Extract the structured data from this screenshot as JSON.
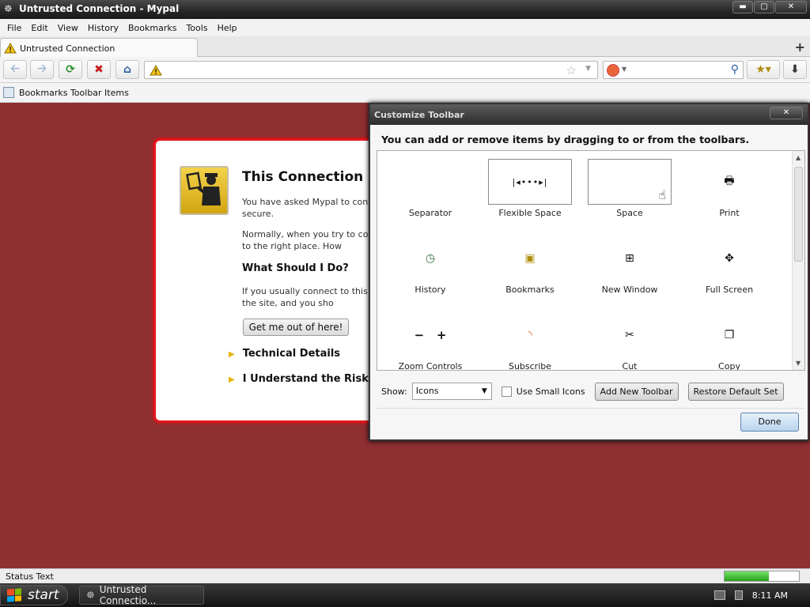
{
  "window": {
    "title": "Untrusted Connection - Mypal",
    "controls": {
      "minimize": "▬",
      "maximize": "▢",
      "close": "✕"
    }
  },
  "menubar": {
    "items": [
      "File",
      "Edit",
      "View",
      "History",
      "Bookmarks",
      "Tools",
      "Help"
    ]
  },
  "tabs": {
    "active_label": "Untrusted Connection",
    "new_tab_symbol": "+"
  },
  "navbar": {
    "url_value": "",
    "search_value": ""
  },
  "bookmarks_toolbar": {
    "item_label": "Bookmarks Toolbar Items"
  },
  "error_page": {
    "title": "This Connection is",
    "para1": "You have asked Mypal to connect connection is secure.",
    "para2": "Normally, when you try to connect are going to the right place. How",
    "heading": "What Should I Do?",
    "para3": "If you usually connect to this site impersonate the site, and you sho",
    "get_out_button": "Get me out of here!",
    "technical_details": "Technical Details",
    "understand_risks": "I Understand the Risks"
  },
  "customize_dialog": {
    "title": "Customize Toolbar",
    "close": "✕",
    "instructions": "You can add or remove items by dragging to or from the toolbars.",
    "palette_items": [
      {
        "label": "Separator",
        "icon": "separator-icon"
      },
      {
        "label": "Flexible Space",
        "icon": "flexible-space-icon"
      },
      {
        "label": "Space",
        "icon": "space-icon"
      },
      {
        "label": "Print",
        "icon": "print-icon"
      },
      {
        "label": "History",
        "icon": "history-icon"
      },
      {
        "label": "Bookmarks",
        "icon": "bookmarks-icon"
      },
      {
        "label": "New Window",
        "icon": "new-window-icon"
      },
      {
        "label": "Full Screen",
        "icon": "full-screen-icon"
      },
      {
        "label": "Zoom Controls",
        "icon": "zoom-controls-icon"
      },
      {
        "label": "Subscribe",
        "icon": "subscribe-icon"
      },
      {
        "label": "Cut",
        "icon": "cut-icon"
      },
      {
        "label": "Copy",
        "icon": "copy-icon"
      }
    ],
    "show_label": "Show:",
    "show_value": "Icons",
    "small_icons_label": "Use Small Icons",
    "small_icons_checked": false,
    "add_toolbar_button": "Add New Toolbar",
    "restore_button": "Restore Default Set",
    "done_button": "Done"
  },
  "statusbar": {
    "text": "Status Text",
    "progress": 0.6
  },
  "taskbar": {
    "start_label": "start",
    "task_label": "Untrusted Connectio...",
    "clock": "8:11 AM"
  },
  "colors": {
    "page_background": "#8e2f32",
    "error_border": "#e3151b",
    "accent": "#2a5d9f"
  }
}
